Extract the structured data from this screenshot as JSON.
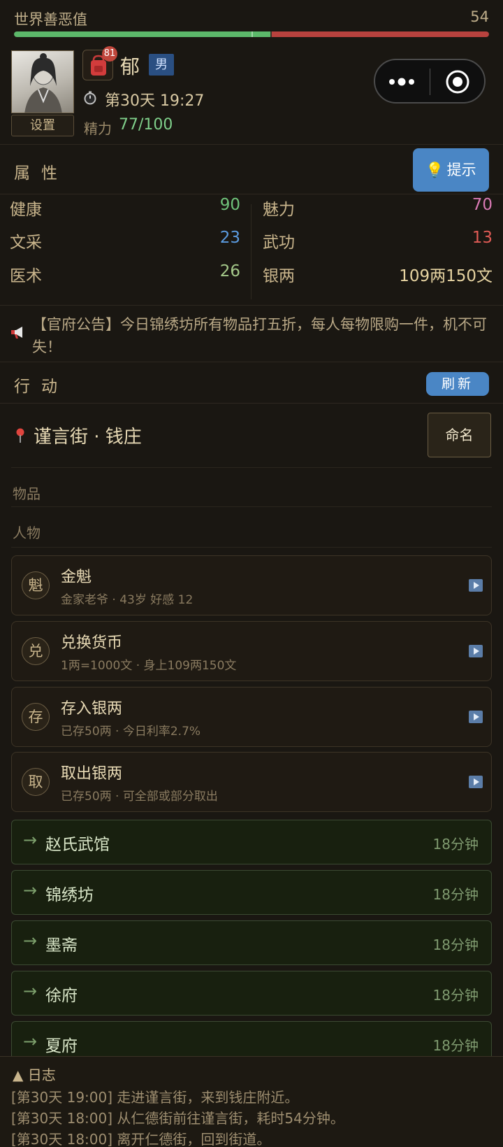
{
  "karma": {
    "label": "世界善恶值",
    "value": "54",
    "good_fraction": 0.54
  },
  "profile": {
    "settings_label": "设置",
    "bag_badge": "81",
    "name": "郁",
    "gender": "男",
    "day_time": "第30天  19:27",
    "energy_label": "精力",
    "energy_value": "77/100"
  },
  "attributes": {
    "title": "属性",
    "hint_label": "提示",
    "left": [
      {
        "key": "健康",
        "value": "90",
        "color": "#6fc37a"
      },
      {
        "key": "文采",
        "value": "23",
        "color": "#5b9be0"
      },
      {
        "key": "医术",
        "value": "26",
        "color": "#a5c98a"
      }
    ],
    "right": [
      {
        "key": "魅力",
        "value": "70",
        "color": "#d879b3"
      },
      {
        "key": "武功",
        "value": "13",
        "color": "#e05b55"
      },
      {
        "key": "银两",
        "value": "109两150文",
        "color": "#e6d3a1"
      }
    ]
  },
  "notice": {
    "text": "【官府公告】今日锦绣坊所有物品打五折，每人每物限购一件，机不可失！"
  },
  "action": {
    "title": "行动",
    "refresh_label": "刷新"
  },
  "location": {
    "name": "谨言街 · 钱庄",
    "rename_label": "命名"
  },
  "sections": {
    "items": "物品",
    "people": "人物"
  },
  "cards": [
    {
      "glyph": "魁",
      "title": "金魁",
      "sub": "金家老爷 · 43岁   好感 12"
    },
    {
      "glyph": "兑",
      "title": "兑换货币",
      "sub": "1两=1000文 · 身上109两150文"
    },
    {
      "glyph": "存",
      "title": "存入银两",
      "sub": "已存50两 · 今日利率2.7%"
    },
    {
      "glyph": "取",
      "title": "取出银两",
      "sub": "已存50两 · 可全部或部分取出"
    }
  ],
  "routes": [
    {
      "arrow": "→",
      "dest": "赵氏武馆",
      "time": "18分钟"
    },
    {
      "arrow": "→",
      "dest": "锦绣坊",
      "time": "18分钟"
    },
    {
      "arrow": "→",
      "dest": "墨斋",
      "time": "18分钟"
    },
    {
      "arrow": "→",
      "dest": "徐府",
      "time": "18分钟"
    },
    {
      "arrow": "→",
      "dest": "夏府",
      "time": "18分钟"
    }
  ],
  "log": {
    "title": "▲  日志",
    "lines": [
      "[第30天 19:00] 走进谨言街，来到钱庄附近。",
      "[第30天 18:00] 从仁德街前往谨言街，耗时54分钟。",
      "[第30天 18:00] 离开仁德街，回到街道。"
    ]
  }
}
